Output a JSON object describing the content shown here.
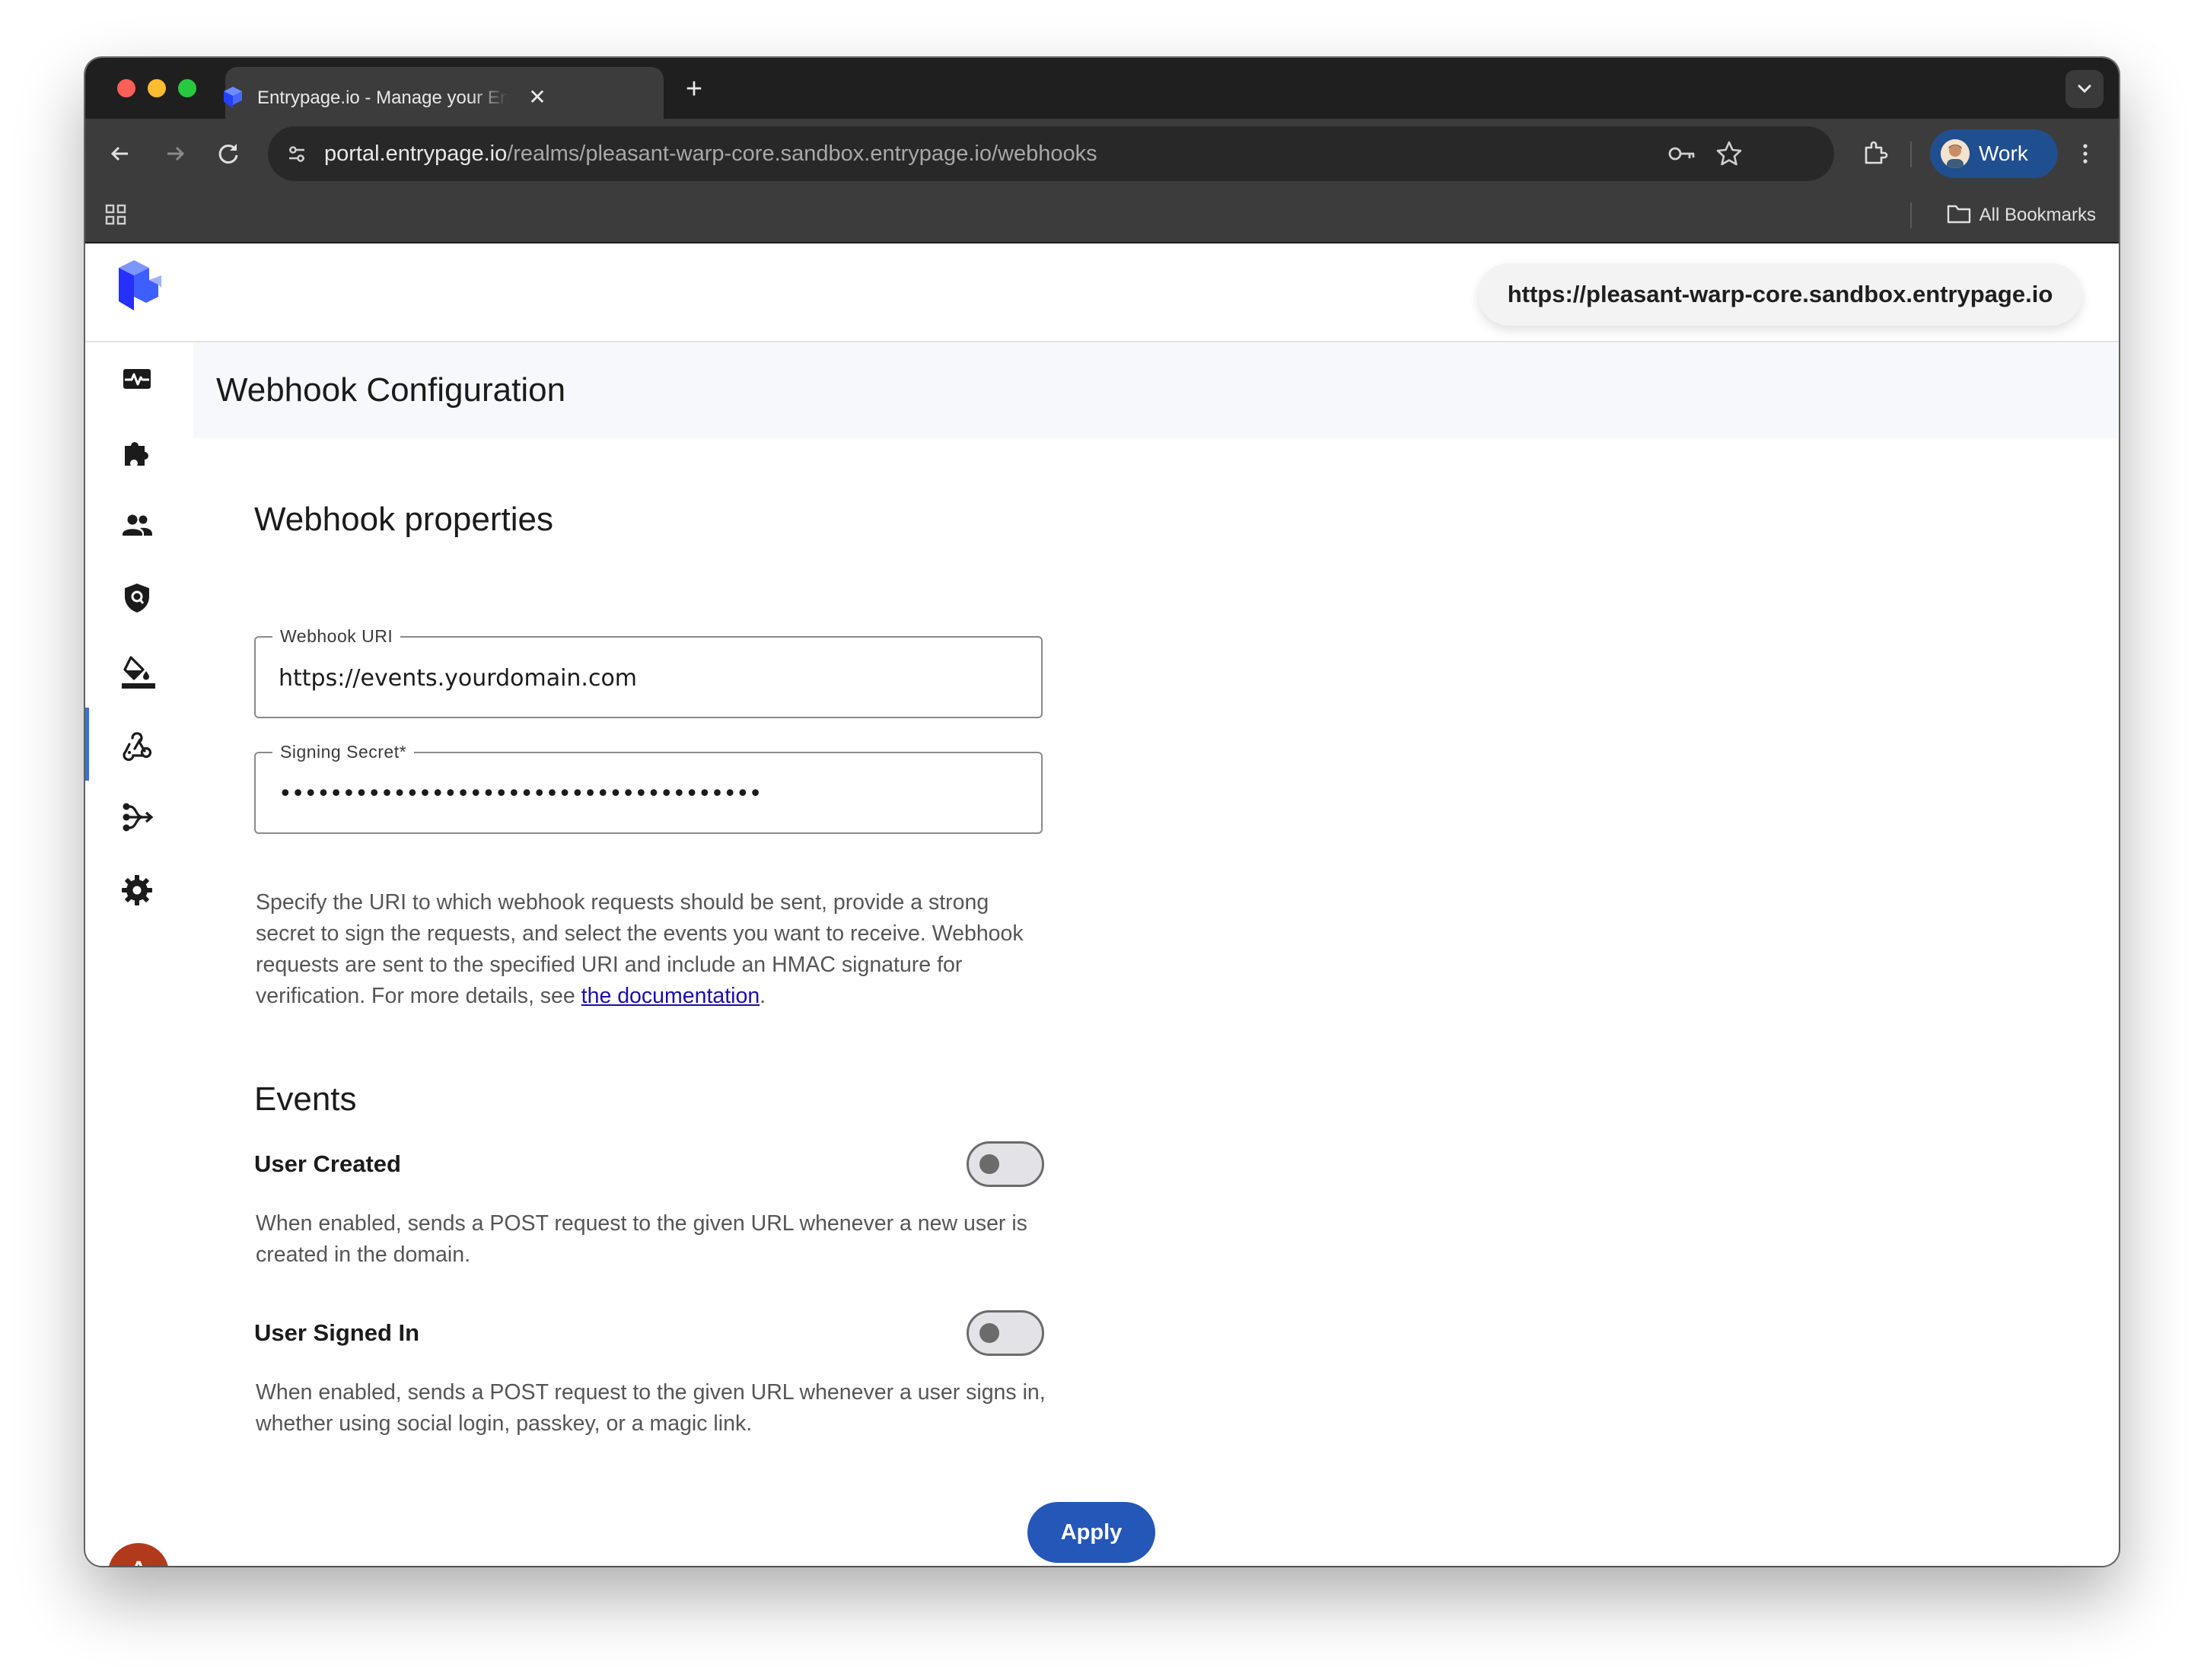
{
  "browser": {
    "tab": {
      "title": "Entrypage.io - Manage your Entrypage",
      "close_glyph": "✕"
    },
    "new_tab_glyph": "+",
    "address": {
      "host": "portal.entrypage.io",
      "path": "/realms/pleasant-warp-core.sandbox.entrypage.io/webhooks"
    },
    "profile": {
      "label": "Work"
    },
    "bookmarks": {
      "all_label": "All Bookmarks"
    },
    "icons": [
      "back-icon",
      "forward-icon",
      "reload-icon",
      "site-settings-icon",
      "password-key-icon",
      "star-icon",
      "extensions-icon",
      "more-icon",
      "apps-grid-icon",
      "folder-icon"
    ]
  },
  "app": {
    "realm_url": "https://pleasant-warp-core.sandbox.entrypage.io",
    "sidebar": {
      "items": [
        {
          "icon": "pulse-icon"
        },
        {
          "icon": "puzzle-icon"
        },
        {
          "icon": "users-icon"
        },
        {
          "icon": "shield-icon"
        },
        {
          "icon": "paint-bucket-icon"
        },
        {
          "icon": "webhook-icon",
          "active": true
        },
        {
          "icon": "flow-icon"
        },
        {
          "icon": "gear-icon"
        }
      ],
      "user_initial": "A"
    },
    "page_title": "Webhook Configuration",
    "properties": {
      "heading": "Webhook properties",
      "uri_label": "Webhook URI",
      "uri_value": "https://events.yourdomain.com",
      "secret_label": "Signing Secret*",
      "secret_value": "••••••••••••••••••••••••••••••••••••••",
      "description_text": "Specify the URI to which webhook requests should be sent, provide a strong secret to sign the requests, and select the events you want to receive. Webhook requests are sent to the specified URI and include an HMAC signature for verification. For more details, see ",
      "description_link": "the documentation",
      "description_end": "."
    },
    "events": {
      "heading": "Events",
      "items": [
        {
          "title": "User Created",
          "enabled": false,
          "description": "When enabled, sends a POST request to the given URL whenever a new user is created in the domain."
        },
        {
          "title": "User Signed In",
          "enabled": false,
          "description": "When enabled, sends a POST request to the given URL whenever a user signs in, whether using social login, passkey, or a magic link."
        }
      ]
    },
    "apply_label": "Apply",
    "colors": {
      "accent": "#2457b8",
      "avatar": "#b23a1c",
      "logo_blue": "#3a5bff"
    }
  }
}
